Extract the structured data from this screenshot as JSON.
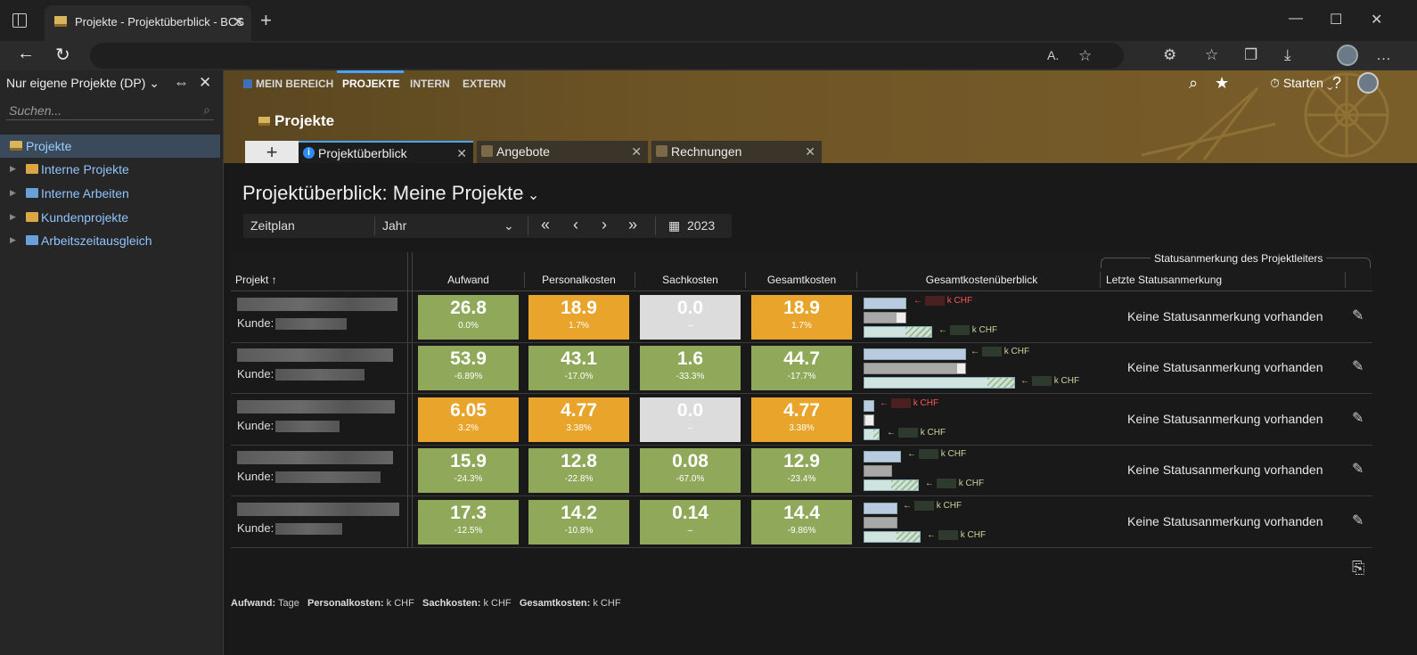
{
  "browser": {
    "tab_title": "Projekte - Projektüberblick - BCS",
    "minimize": "—",
    "maximize": "☐",
    "close": "✕"
  },
  "sidebar": {
    "header": "Nur eigene Projekte (DP)",
    "search_placeholder": "Suchen...",
    "items": [
      {
        "label": "Projekte",
        "selected": true
      },
      {
        "label": "Interne Projekte"
      },
      {
        "label": "Interne Arbeiten"
      },
      {
        "label": "Kundenprojekte"
      },
      {
        "label": "Arbeitszeitausgleich"
      }
    ]
  },
  "topnav": {
    "items": [
      "MEIN BEREICH",
      "PROJEKTE",
      "INTERN",
      "EXTERN"
    ],
    "active": "PROJEKTE",
    "starten": "Starten"
  },
  "page": {
    "section_title": "Projekte",
    "tabs": [
      "Projektüberblick",
      "Angebote",
      "Rechnungen"
    ],
    "add_tab": "+",
    "heading": "Projektüberblick: Meine Projekte",
    "controls": {
      "mode": "Zeitplan",
      "period": "Jahr",
      "first": "«",
      "prev": "‹",
      "next": "›",
      "last": "»",
      "year": "2023"
    }
  },
  "table": {
    "headers": {
      "project": "Projekt ↑",
      "aufwand": "Aufwand",
      "personal": "Personalkosten",
      "sach": "Sachkosten",
      "gesamt": "Gesamtkosten",
      "overview": "Gesamtkostenüberblick",
      "group": "Statusanmerkung des Projektleiters",
      "status": "Letzte Statusanmerkung"
    },
    "kunde_label": "Kunde:",
    "unit": "k CHF",
    "status_text": "Keine Statusanmerkung vorhanden",
    "rows": [
      {
        "aufwand": "26.8",
        "aufwand_p": "0.0%",
        "aufwand_c": "green",
        "personal": "18.9",
        "personal_p": "1.7%",
        "personal_c": "orange",
        "sach": "0.0",
        "sach_p": "–",
        "sach_c": "gray",
        "gesamt": "18.9",
        "gesamt_p": "1.7%",
        "gesamt_c": "orange"
      },
      {
        "aufwand": "53.9",
        "aufwand_p": "-6.89%",
        "aufwand_c": "green",
        "personal": "43.1",
        "personal_p": "-17.0%",
        "personal_c": "green",
        "sach": "1.6",
        "sach_p": "-33.3%",
        "sach_c": "green",
        "gesamt": "44.7",
        "gesamt_p": "-17.7%",
        "gesamt_c": "green"
      },
      {
        "aufwand": "6.05",
        "aufwand_p": "3.2%",
        "aufwand_c": "orange",
        "personal": "4.77",
        "personal_p": "3.38%",
        "personal_c": "orange",
        "sach": "0.0",
        "sach_p": "–",
        "sach_c": "gray",
        "gesamt": "4.77",
        "gesamt_p": "3.38%",
        "gesamt_c": "orange"
      },
      {
        "aufwand": "15.9",
        "aufwand_p": "-24.3%",
        "aufwand_c": "green",
        "personal": "12.8",
        "personal_p": "-22.8%",
        "personal_c": "green",
        "sach": "0.08",
        "sach_p": "-67.0%",
        "sach_c": "green",
        "gesamt": "12.9",
        "gesamt_p": "-23.4%",
        "gesamt_c": "green"
      },
      {
        "aufwand": "17.3",
        "aufwand_p": "-12.5%",
        "aufwand_c": "green",
        "personal": "14.2",
        "personal_p": "-10.8%",
        "personal_c": "green",
        "sach": "0.14",
        "sach_p": "–",
        "sach_c": "green",
        "gesamt": "14.4",
        "gesamt_p": "-9.86%",
        "gesamt_c": "green"
      }
    ]
  },
  "legend": {
    "aufwand_k": "Aufwand:",
    "aufwand_v": "Tage",
    "personal_k": "Personalkosten:",
    "personal_v": "k CHF",
    "sach_k": "Sachkosten:",
    "sach_v": "k CHF",
    "gesamt_k": "Gesamtkosten:",
    "gesamt_v": "k CHF"
  },
  "colors": {
    "green": "#8fa85a",
    "orange": "#e9a42c",
    "gray": "#dcdcdc",
    "accent": "#4aa3ff"
  }
}
